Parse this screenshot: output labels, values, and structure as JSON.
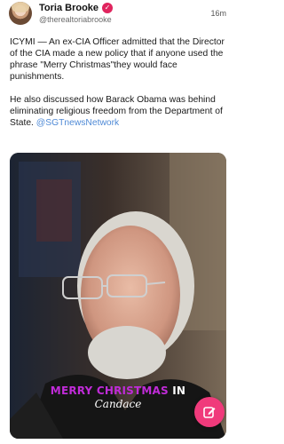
{
  "post": {
    "author_name": "Toria Brooke",
    "handle": "@therealtoriabrooke",
    "time": "16m",
    "verified_icon": "check-badge-icon",
    "paragraph1": "ICYMI — An ex-CIA Officer admitted that the Director of the CIA made a new policy that if anyone used the phrase \"Merry Christmas\"they would face punishments.",
    "paragraph2_text": "He also discussed how Barack Obama was behind eliminating religious freedom from the Department of State. ",
    "mention": "@SGTnewsNetwork"
  },
  "media": {
    "caption_colored": "MERRY CHRISTMAS",
    "caption_white": " IN",
    "caption_sub": "Candace"
  },
  "compose_button": {
    "icon": "pencil-edit-icon"
  },
  "colors": {
    "verified": "#e0245e",
    "mention": "#4f8ad6",
    "caption": "#c02bd8",
    "fab": "#f03a7b"
  }
}
